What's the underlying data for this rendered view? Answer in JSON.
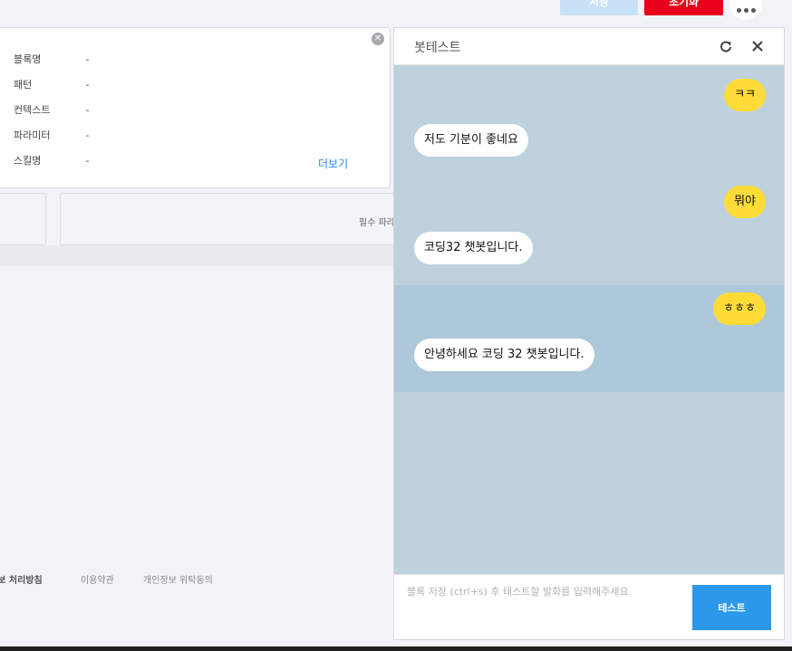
{
  "toolbar": {
    "save_label": "저장",
    "reset_label": "초기화"
  },
  "block_info": {
    "rows": [
      {
        "label": "블록명",
        "value": "-"
      },
      {
        "label": "패턴",
        "value": "-"
      },
      {
        "label": "컨텍스트",
        "value": "-"
      },
      {
        "label": "파라미터",
        "value": "-"
      },
      {
        "label": "스킬명",
        "value": "-"
      }
    ],
    "more_label": "더보기"
  },
  "required_params_text": "필수 파라",
  "footer": {
    "privacy": "정보 처리방침",
    "terms": "이용약관",
    "consignment": "개인정보 위탁동의"
  },
  "bot_test": {
    "title": "봇테스트",
    "messages": [
      {
        "from": "user",
        "text": "ㅋㅋ"
      },
      {
        "from": "bot",
        "text": "저도 기분이 좋네요"
      },
      {
        "from": "user",
        "text": "뭐야"
      },
      {
        "from": "bot",
        "text": "코딩32 챗봇입니다."
      },
      {
        "from": "user",
        "text": "ㅎㅎㅎ"
      },
      {
        "from": "bot",
        "text": "안녕하세요 코딩 32 챗봇입니다."
      }
    ],
    "input_placeholder": "블록 저장 (ctrl+s) 후 테스트할 발화를 입력해주세요",
    "send_label": "테스트"
  },
  "colors": {
    "reset": "#e8001c",
    "save": "#c9e1f6",
    "send": "#2b98ea",
    "user_bubble": "#ffdb38",
    "chat_bg": "#bed2dd"
  }
}
